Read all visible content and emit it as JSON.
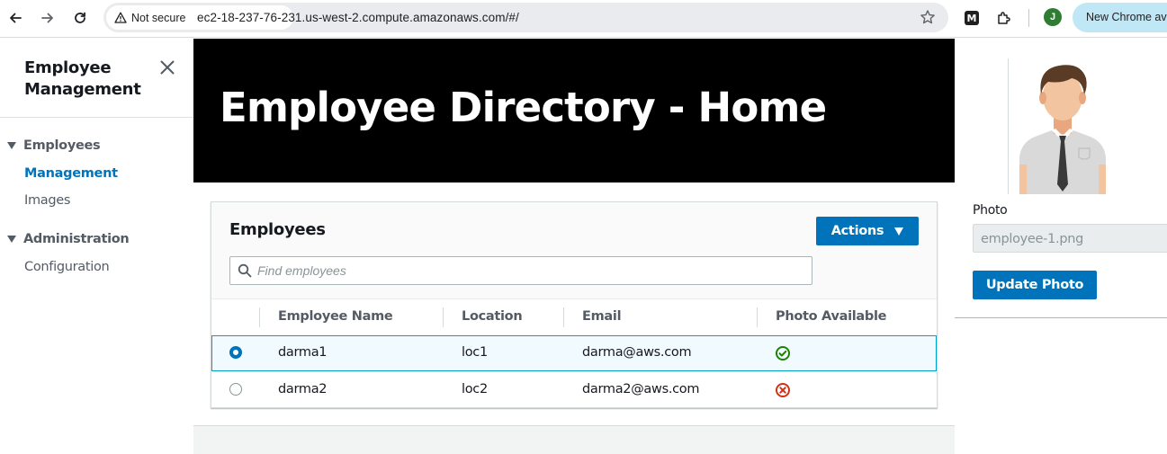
{
  "browser": {
    "security_label": "Not secure",
    "url": "ec2-18-237-76-231.us-west-2.compute.amazonaws.com/#/",
    "profile_initial": "J",
    "new_chrome_label": "New Chrome ava",
    "extension_m_label": "M"
  },
  "sidenav": {
    "title": "Employee Management",
    "sections": [
      {
        "label": "Employees",
        "items": [
          {
            "label": "Management",
            "active": true
          },
          {
            "label": "Images",
            "active": false
          }
        ]
      },
      {
        "label": "Administration",
        "items": [
          {
            "label": "Configuration",
            "active": false
          }
        ]
      }
    ]
  },
  "hero": {
    "title": "Employee Directory - Home"
  },
  "table": {
    "title": "Employees",
    "actions_label": "Actions",
    "search_placeholder": "Find employees",
    "columns": [
      "Employee Name",
      "Location",
      "Email",
      "Photo Available"
    ],
    "rows": [
      {
        "name": "darma1",
        "location": "loc1",
        "email": "darma@aws.com",
        "photo_available": true,
        "selected": true
      },
      {
        "name": "darma2",
        "location": "loc2",
        "email": "darma2@aws.com",
        "photo_available": false,
        "selected": false
      }
    ]
  },
  "detail": {
    "photo_label": "Photo",
    "photo_filename": "employee-1.png",
    "update_button": "Update Photo"
  },
  "colors": {
    "primary": "#0073bb",
    "selected_row_bg": "#f1faff",
    "selected_row_border": "#00a1c9",
    "success": "#1d8102",
    "error": "#d13212"
  }
}
